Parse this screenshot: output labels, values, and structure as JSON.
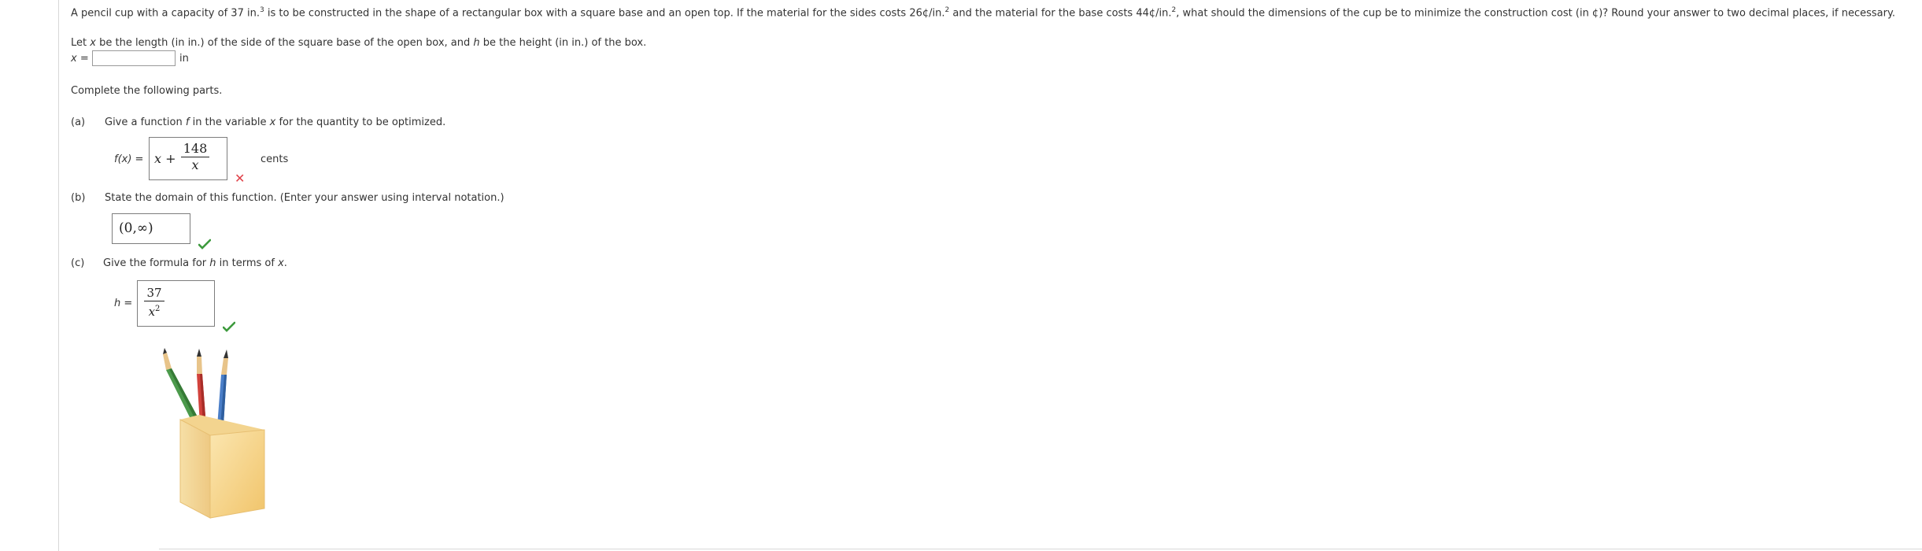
{
  "problem": {
    "intro_1": "A pencil cup with a capacity of",
    "capacity_value": "37",
    "intro_unit": "in.",
    "intro_exp": "3",
    "intro_2": "is to be constructed in the shape of a rectangular box with a square base and an open top. If the material for the sides costs",
    "side_cost": "26¢/in.",
    "side_exp": "2",
    "intro_3": "and the material for the base costs",
    "base_cost": "44¢/in.",
    "base_exp": "2",
    "intro_4": ", what should the dimensions of the cup be to minimize the construction cost (in ¢)? Round your answer to two decimal places, if necessary."
  },
  "let_line": {
    "a": "Let",
    "x": "x",
    "b": "be the length (in in.) of the side of the square base of the open box, and",
    "h": "h",
    "c": "be the height (in in.) of the box."
  },
  "x_input": {
    "label": "x =",
    "value": "",
    "unit": "in"
  },
  "complete_text": "Complete the following parts.",
  "part_a": {
    "letter": "(a)",
    "text_1": "Give a function",
    "f": "f",
    "text_2": "in the variable",
    "x": "x",
    "text_3": "for the quantity to be optimized.",
    "label": "f(x) =",
    "answer_term": "x +",
    "numerator": "148",
    "denominator": "x",
    "unit": "cents",
    "status": "incorrect"
  },
  "part_b": {
    "letter": "(b)",
    "text": "State the domain of this function. (Enter your answer using interval notation.)",
    "answer": "(0,∞)",
    "status": "correct"
  },
  "part_c": {
    "letter": "(c)",
    "text_1": "Give the formula for",
    "h": "h",
    "text_2": "in terms of",
    "x": "x",
    "text_3": ".",
    "label": "h =",
    "numerator": "37",
    "denominator_base": "x",
    "denominator_exp": "2",
    "status": "correct"
  },
  "illustration": {
    "icon": "pencil-cup-icon",
    "pencil_colors": [
      "#4c9a4c",
      "#d2423c",
      "#4a7ec8"
    ],
    "cup_color": "#f6d98f"
  },
  "colors": {
    "incorrect": "#e0424a",
    "correct": "#3d9a3d"
  }
}
